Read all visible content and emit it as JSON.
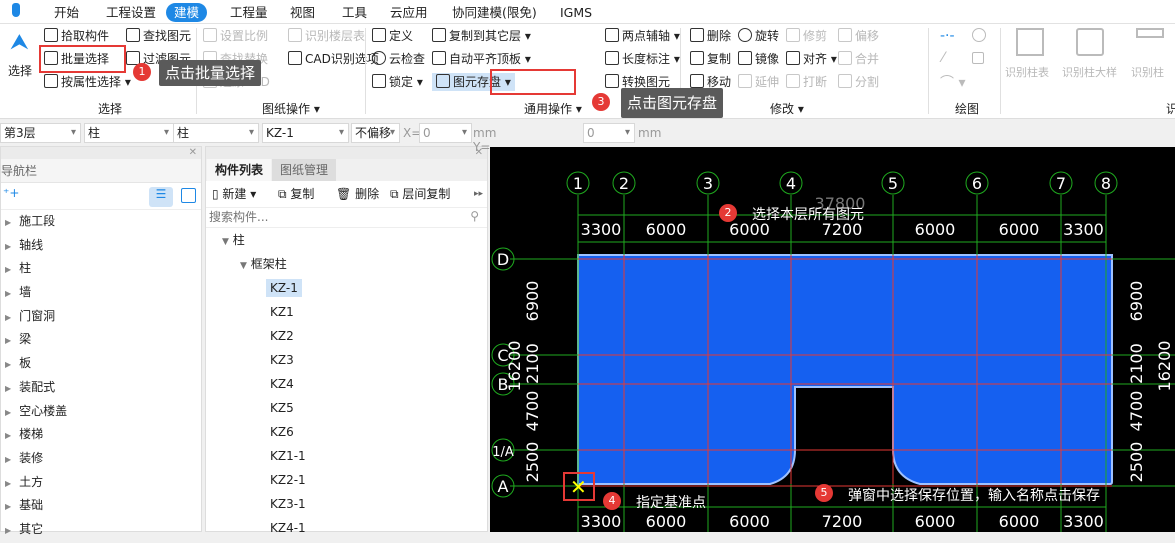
{
  "tabs": [
    "开始",
    "工程设置",
    "建模",
    "工程量",
    "视图",
    "工具",
    "云应用",
    "协同建模(限免)",
    "IGMS"
  ],
  "active_tab": "建模",
  "ribbon": {
    "select_group": {
      "select": "选择",
      "pick": "拾取构件",
      "batch": "批量选择",
      "by_attr": "按属性选择",
      "find": "查找图元",
      "filter": "过滤图元",
      "label": "选择"
    },
    "drawing_group": {
      "scale": "设置比例",
      "floor_table": "识别楼层表",
      "find_replace": "查找替换",
      "cad_options": "CAD识别选项",
      "restore_cad": "还原CAD",
      "label": "图纸操作"
    },
    "common_group": {
      "define": "定义",
      "cloud_check": "云检查",
      "lock": "锁定",
      "copy_to": "复制到其它层",
      "auto_align": "自动平齐顶板",
      "save_elem": "图元存盘",
      "two_point_axis": "两点辅轴",
      "dim": "长度标注",
      "convert": "转换图元",
      "label": "通用操作"
    },
    "modify_group": {
      "delete": "删除",
      "copy": "复制",
      "move": "移动",
      "rotate": "旋转",
      "mirror": "镜像",
      "extend": "延伸",
      "trim": "修剪",
      "align": "对齐",
      "break": "打断",
      "offset": "偏移",
      "merge": "合并",
      "split": "分割",
      "label": "修改"
    },
    "draw_group": {
      "label": "绘图"
    },
    "recognize_group": {
      "col_table": "识别柱表",
      "col_detail": "识别柱大样",
      "col": "识别柱",
      "label": "识"
    }
  },
  "annotations": [
    {
      "n": "1",
      "text": "点击批量选择"
    },
    {
      "n": "2",
      "text": "选择本层所有图元"
    },
    {
      "n": "3",
      "text": "点击图元存盘"
    },
    {
      "n": "4",
      "text": "指定基准点"
    },
    {
      "n": "5",
      "text": "弹窗中选择保存位置，输入名称点击保存"
    }
  ],
  "propbar": {
    "floor": "第3层",
    "type1": "柱",
    "type2": "柱",
    "comp": "KZ-1",
    "offset": "不偏移",
    "x_label": "X=",
    "x": "0",
    "y_label": "mm Y=",
    "y": "0",
    "unit": "mm"
  },
  "nav": {
    "title": "导航栏",
    "items": [
      "施工段",
      "轴线",
      "柱",
      "墙",
      "门窗洞",
      "梁",
      "板",
      "装配式",
      "空心楼盖",
      "楼梯",
      "装修",
      "土方",
      "基础",
      "其它"
    ]
  },
  "components": {
    "tabs": [
      "构件列表",
      "图纸管理"
    ],
    "new": "新建",
    "copy": "复制",
    "delete": "删除",
    "floor_copy": "层间复制",
    "search_placeholder": "搜索构件...",
    "root": "柱",
    "sub": "框架柱",
    "items": [
      "KZ-1",
      "KZ1",
      "KZ2",
      "KZ3",
      "KZ4",
      "KZ5",
      "KZ6",
      "KZ1-1",
      "KZ2-1",
      "KZ3-1",
      "KZ4-1"
    ],
    "selected": "KZ-1"
  },
  "cad": {
    "axes_x": [
      "1",
      "2",
      "3",
      "4",
      "5",
      "6",
      "7",
      "8"
    ],
    "axes_y": [
      "D",
      "C",
      "B",
      "1/A",
      "A"
    ],
    "top_total": "37800",
    "top_dims": [
      "3300",
      "6000",
      "6000",
      "7200",
      "6000",
      "6000",
      "3300"
    ],
    "bottom_dims": [
      "3300",
      "6000",
      "6000",
      "7200",
      "6000",
      "6000",
      "3300"
    ],
    "side_dims": [
      "6900",
      "2100",
      "4700",
      "2500"
    ],
    "side_total": "16200"
  },
  "colors": {
    "accent": "#1e88e5",
    "highlight": "#e53935",
    "slab": "#1560f0",
    "grid": "#1faa1f"
  }
}
